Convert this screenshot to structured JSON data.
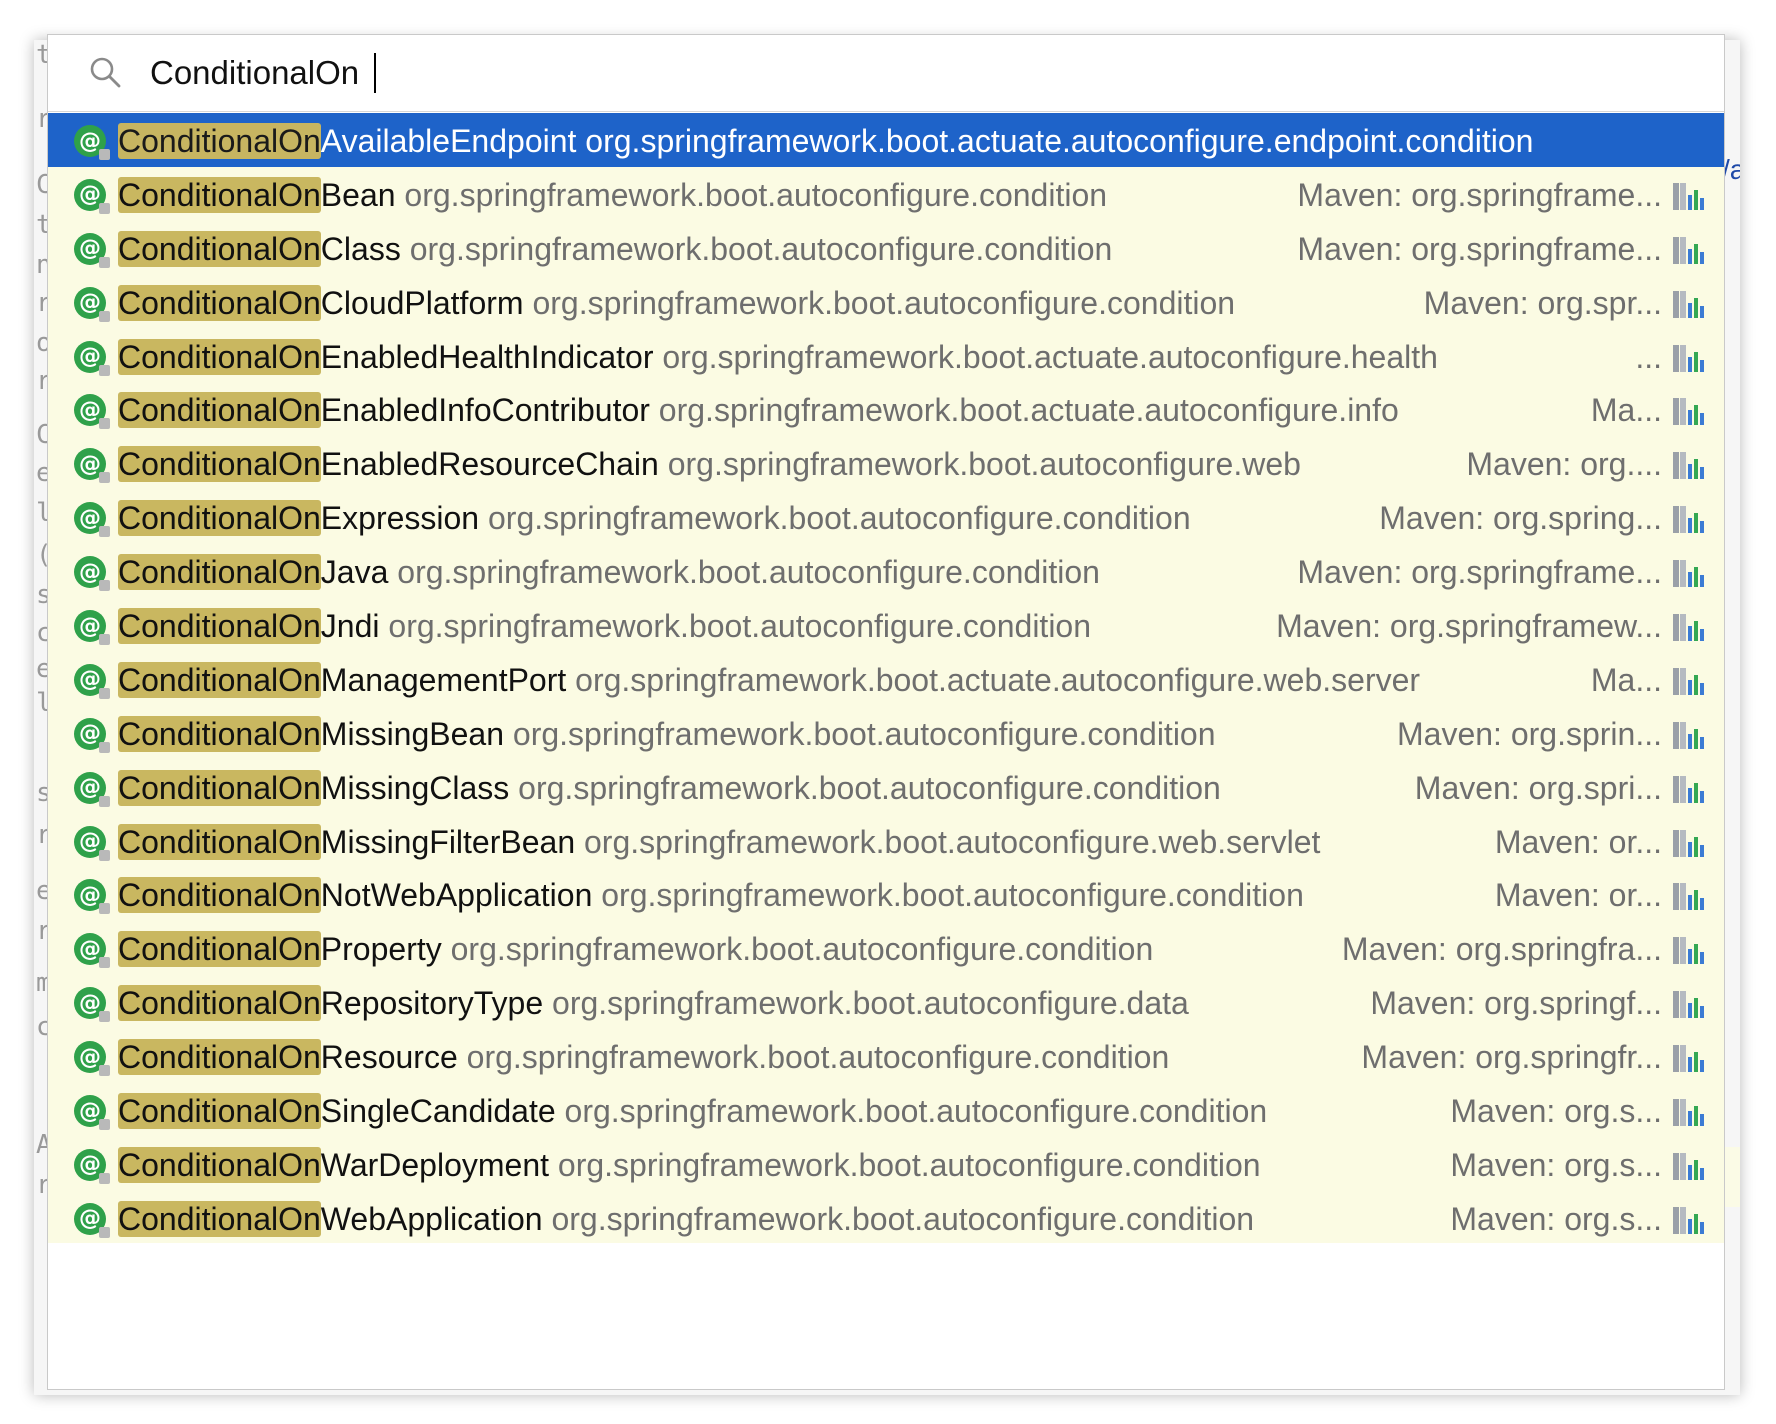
{
  "search": {
    "query": "ConditionalOn",
    "placeholder": ""
  },
  "colors": {
    "selection": "#1e63c9",
    "list_background": "#fbfbe3",
    "match_highlight": "#c9b760",
    "annotation_icon": "#2fa14a"
  },
  "results": [
    {
      "match": "ConditionalOn",
      "rest": "AvailableEndpoint",
      "package": "org.springframework.boot.actuate.autoconfigure.endpoint.condition",
      "location": "",
      "icon": "annotation-icon",
      "selected": true
    },
    {
      "match": "ConditionalOn",
      "rest": "Bean",
      "package": "org.springframework.boot.autoconfigure.condition",
      "location": "Maven: org.springframe...",
      "icon": "annotation-icon"
    },
    {
      "match": "ConditionalOn",
      "rest": "Class",
      "package": "org.springframework.boot.autoconfigure.condition",
      "location": "Maven: org.springframe...",
      "icon": "annotation-icon"
    },
    {
      "match": "ConditionalOn",
      "rest": "CloudPlatform",
      "package": "org.springframework.boot.autoconfigure.condition",
      "location": "Maven: org.spr...",
      "icon": "annotation-icon"
    },
    {
      "match": "ConditionalOn",
      "rest": "EnabledHealthIndicator",
      "package": "org.springframework.boot.actuate.autoconfigure.health",
      "location": "...",
      "icon": "annotation-icon"
    },
    {
      "match": "ConditionalOn",
      "rest": "EnabledInfoContributor",
      "package": "org.springframework.boot.actuate.autoconfigure.info",
      "location": "Ma...",
      "icon": "annotation-icon"
    },
    {
      "match": "ConditionalOn",
      "rest": "EnabledResourceChain",
      "package": "org.springframework.boot.autoconfigure.web",
      "location": "Maven: org....",
      "icon": "annotation-icon"
    },
    {
      "match": "ConditionalOn",
      "rest": "Expression",
      "package": "org.springframework.boot.autoconfigure.condition",
      "location": "Maven: org.spring...",
      "icon": "annotation-icon"
    },
    {
      "match": "ConditionalOn",
      "rest": "Java",
      "package": "org.springframework.boot.autoconfigure.condition",
      "location": "Maven: org.springframe...",
      "icon": "annotation-icon"
    },
    {
      "match": "ConditionalOn",
      "rest": "Jndi",
      "package": "org.springframework.boot.autoconfigure.condition",
      "location": "Maven: org.springframew...",
      "icon": "annotation-icon"
    },
    {
      "match": "ConditionalOn",
      "rest": "ManagementPort",
      "package": "org.springframework.boot.actuate.autoconfigure.web.server",
      "location": "Ma...",
      "icon": "annotation-icon"
    },
    {
      "match": "ConditionalOn",
      "rest": "MissingBean",
      "package": "org.springframework.boot.autoconfigure.condition",
      "location": "Maven: org.sprin...",
      "icon": "annotation-icon"
    },
    {
      "match": "ConditionalOn",
      "rest": "MissingClass",
      "package": "org.springframework.boot.autoconfigure.condition",
      "location": "Maven: org.spri...",
      "icon": "annotation-icon"
    },
    {
      "match": "ConditionalOn",
      "rest": "MissingFilterBean",
      "package": "org.springframework.boot.autoconfigure.web.servlet",
      "location": "Maven: or...",
      "icon": "annotation-icon"
    },
    {
      "match": "ConditionalOn",
      "rest": "NotWebApplication",
      "package": "org.springframework.boot.autoconfigure.condition",
      "location": "Maven: or...",
      "icon": "annotation-icon"
    },
    {
      "match": "ConditionalOn",
      "rest": "Property",
      "package": "org.springframework.boot.autoconfigure.condition",
      "location": "Maven: org.springfra...",
      "icon": "annotation-icon"
    },
    {
      "match": "ConditionalOn",
      "rest": "RepositoryType",
      "package": "org.springframework.boot.autoconfigure.data",
      "location": "Maven: org.springf...",
      "icon": "annotation-icon"
    },
    {
      "match": "ConditionalOn",
      "rest": "Resource",
      "package": "org.springframework.boot.autoconfigure.condition",
      "location": "Maven: org.springfr...",
      "icon": "annotation-icon"
    },
    {
      "match": "ConditionalOn",
      "rest": "SingleCandidate",
      "package": "org.springframework.boot.autoconfigure.condition",
      "location": "Maven: org.s...",
      "icon": "annotation-icon"
    },
    {
      "match": "ConditionalOn",
      "rest": "WarDeployment",
      "package": "org.springframework.boot.autoconfigure.condition",
      "location": "Maven: org.s...",
      "icon": "annotation-icon"
    },
    {
      "match": "ConditionalOn",
      "rest": "WebApplication",
      "package": "org.springframework.boot.autoconfigure.condition",
      "location": "Maven: org.s...",
      "icon": "annotation-icon"
    }
  ],
  "editor_fragments": {
    "left_gutter": [
      "ti",
      "r.",
      "C",
      "t",
      "nj",
      "r",
      "ot",
      "r",
      "Co",
      "ec",
      "la",
      "(",
      "su",
      "ce",
      "er",
      "li",
      "s",
      "r",
      "e",
      "r",
      "m",
      "c",
      "A",
      "r"
    ],
    "right_glyph": "/a"
  }
}
